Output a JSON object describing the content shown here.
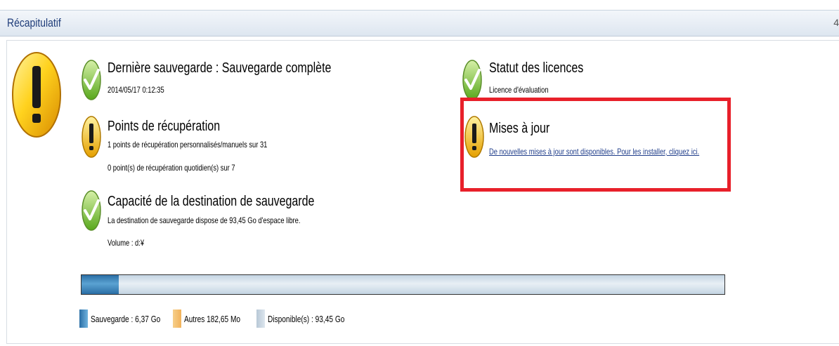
{
  "header": {
    "title": "Récapitulatif",
    "collapse_glyph": "4"
  },
  "summary": {
    "overall_status_icon": "warning-icon",
    "last_backup": {
      "icon": "check-icon",
      "title": "Dernière sauvegarde : Sauvegarde complète",
      "timestamp": "2014/05/17 0:12:35"
    },
    "recovery_points": {
      "icon": "warning-icon",
      "title": "Points de récupération",
      "line1": "1 points de récupération personnalisés/manuels sur 31",
      "line2": "0 point(s) de récupération quotidien(s) sur 7"
    },
    "destination_capacity": {
      "icon": "check-icon",
      "title": "Capacité de la destination de sauvegarde",
      "line1": "La destination de sauvegarde dispose de 93,45 Go d'espace libre.",
      "line2": "Volume : d:¥"
    },
    "license_status": {
      "icon": "check-icon",
      "title": "Statut des licences",
      "detail": "Licence d'évaluation"
    },
    "updates": {
      "icon": "warning-icon",
      "title": "Mises à jour",
      "link": "De nouvelles mises à jour sont disponibles. Pour les installer, cliquez ici."
    }
  },
  "capacity": {
    "backup_fraction": 0.058,
    "legend": {
      "backup": "Sauvegarde : 6,37 Go",
      "other": "Autres 182,65 Mo",
      "available": "Disponible(s) : 93,45 Go"
    }
  },
  "colors": {
    "backup": "#2f7ab5",
    "other": "#f2b25a",
    "available": "#c9d6e2",
    "highlight": "#e8202a",
    "link": "#1f3d8a"
  }
}
